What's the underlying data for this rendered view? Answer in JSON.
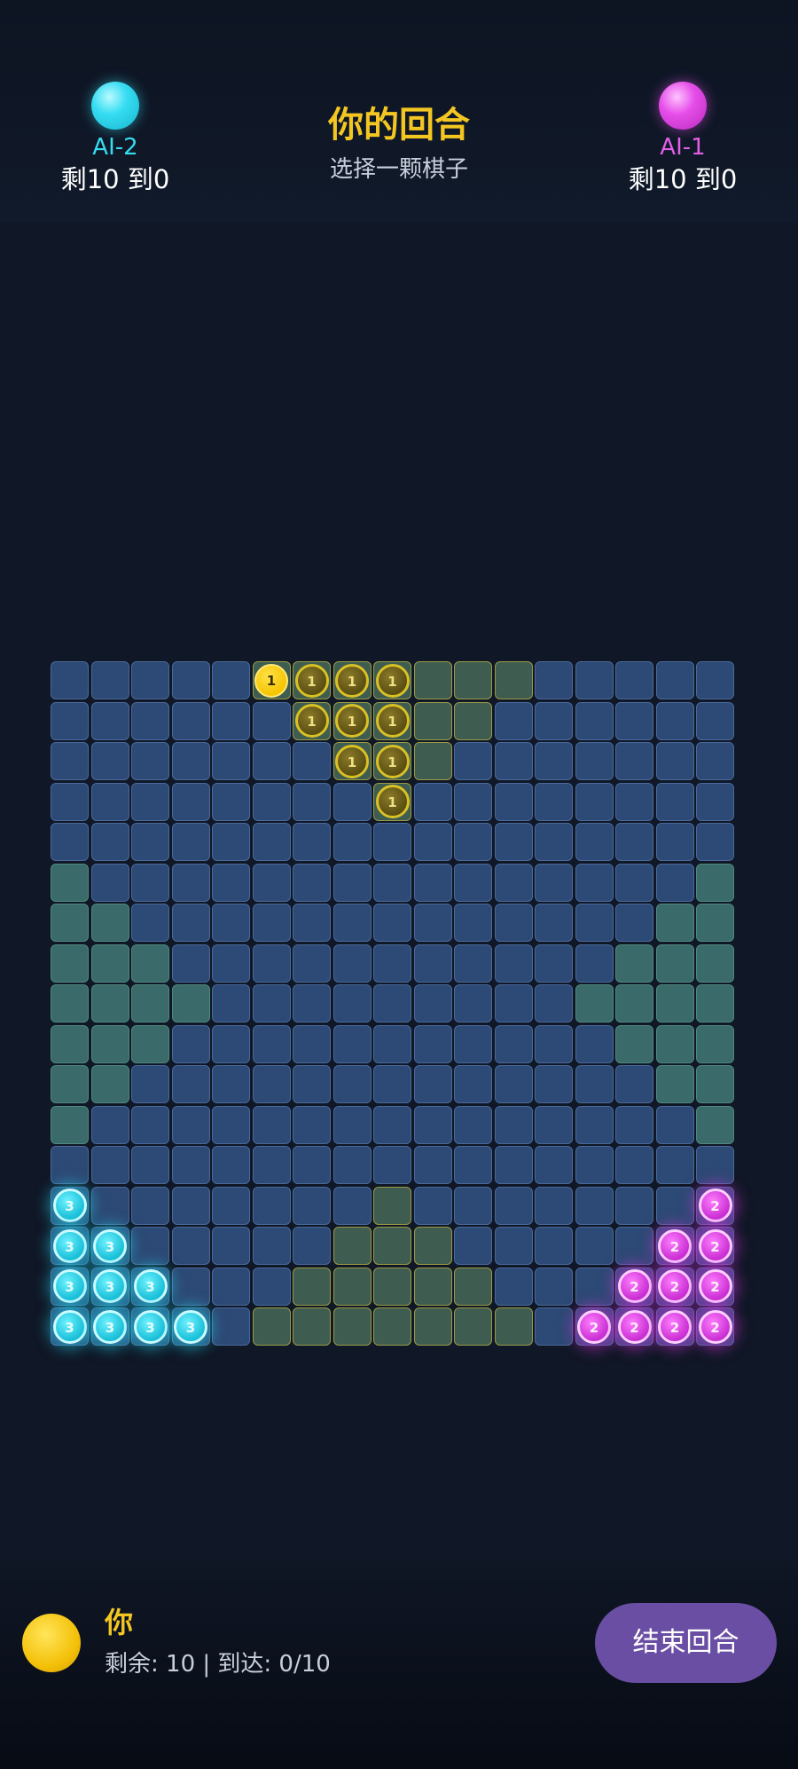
{
  "top_bar": {
    "left_player": {
      "name": "AI-2",
      "stats": "剩10 到0",
      "color": "#35dcf2"
    },
    "right_player": {
      "name": "AI-1",
      "stats": "剩10 到0",
      "color": "#e35ee6"
    },
    "turn_title": "你的回合",
    "turn_subtitle": "选择一颗棋子"
  },
  "board": {
    "size": 17,
    "colors": {
      "cell": "#2d4975",
      "home_green": "#3a6a6a",
      "home_yellow": "#3e5c50",
      "yellow": "#f3c622",
      "cyan": "#35dcf2",
      "magenta": "#e35ee6"
    },
    "home_zones": {
      "top": [
        [
          0,
          5
        ],
        [
          0,
          6
        ],
        [
          0,
          7
        ],
        [
          0,
          8
        ],
        [
          0,
          9
        ],
        [
          0,
          10
        ],
        [
          0,
          11
        ],
        [
          1,
          6
        ],
        [
          1,
          7
        ],
        [
          1,
          8
        ],
        [
          1,
          9
        ],
        [
          1,
          10
        ],
        [
          2,
          7
        ],
        [
          2,
          8
        ],
        [
          2,
          9
        ],
        [
          3,
          8
        ]
      ],
      "bottom": [
        [
          13,
          8
        ],
        [
          14,
          7
        ],
        [
          14,
          8
        ],
        [
          14,
          9
        ],
        [
          15,
          6
        ],
        [
          15,
          7
        ],
        [
          15,
          8
        ],
        [
          15,
          9
        ],
        [
          15,
          10
        ],
        [
          16,
          5
        ],
        [
          16,
          6
        ],
        [
          16,
          7
        ],
        [
          16,
          8
        ],
        [
          16,
          9
        ],
        [
          16,
          10
        ],
        [
          16,
          11
        ]
      ],
      "left": [
        [
          5,
          0
        ],
        [
          6,
          0
        ],
        [
          6,
          1
        ],
        [
          7,
          0
        ],
        [
          7,
          1
        ],
        [
          7,
          2
        ],
        [
          8,
          0
        ],
        [
          8,
          1
        ],
        [
          8,
          2
        ],
        [
          8,
          3
        ],
        [
          9,
          0
        ],
        [
          9,
          1
        ],
        [
          9,
          2
        ],
        [
          10,
          0
        ],
        [
          10,
          1
        ],
        [
          11,
          0
        ]
      ],
      "right": [
        [
          5,
          16
        ],
        [
          6,
          15
        ],
        [
          6,
          16
        ],
        [
          7,
          14
        ],
        [
          7,
          15
        ],
        [
          7,
          16
        ],
        [
          8,
          13
        ],
        [
          8,
          14
        ],
        [
          8,
          15
        ],
        [
          8,
          16
        ],
        [
          9,
          14
        ],
        [
          9,
          15
        ],
        [
          9,
          16
        ],
        [
          10,
          15
        ],
        [
          10,
          16
        ],
        [
          11,
          16
        ]
      ]
    },
    "pieces": [
      {
        "row": 0,
        "col": 5,
        "color": "yellow",
        "label": "1",
        "selected": true
      },
      {
        "row": 0,
        "col": 6,
        "color": "yellow",
        "label": "1"
      },
      {
        "row": 0,
        "col": 7,
        "color": "yellow",
        "label": "1"
      },
      {
        "row": 0,
        "col": 8,
        "color": "yellow",
        "label": "1"
      },
      {
        "row": 1,
        "col": 6,
        "color": "yellow",
        "label": "1"
      },
      {
        "row": 1,
        "col": 7,
        "color": "yellow",
        "label": "1"
      },
      {
        "row": 1,
        "col": 8,
        "color": "yellow",
        "label": "1"
      },
      {
        "row": 2,
        "col": 7,
        "color": "yellow",
        "label": "1"
      },
      {
        "row": 2,
        "col": 8,
        "color": "yellow",
        "label": "1"
      },
      {
        "row": 3,
        "col": 8,
        "color": "yellow",
        "label": "1"
      },
      {
        "row": 13,
        "col": 0,
        "color": "cyan",
        "label": "3"
      },
      {
        "row": 14,
        "col": 0,
        "color": "cyan",
        "label": "3"
      },
      {
        "row": 14,
        "col": 1,
        "color": "cyan",
        "label": "3"
      },
      {
        "row": 15,
        "col": 0,
        "color": "cyan",
        "label": "3"
      },
      {
        "row": 15,
        "col": 1,
        "color": "cyan",
        "label": "3"
      },
      {
        "row": 15,
        "col": 2,
        "color": "cyan",
        "label": "3"
      },
      {
        "row": 16,
        "col": 0,
        "color": "cyan",
        "label": "3"
      },
      {
        "row": 16,
        "col": 1,
        "color": "cyan",
        "label": "3"
      },
      {
        "row": 16,
        "col": 2,
        "color": "cyan",
        "label": "3"
      },
      {
        "row": 16,
        "col": 3,
        "color": "cyan",
        "label": "3"
      },
      {
        "row": 13,
        "col": 16,
        "color": "magenta",
        "label": "2"
      },
      {
        "row": 14,
        "col": 15,
        "color": "magenta",
        "label": "2"
      },
      {
        "row": 14,
        "col": 16,
        "color": "magenta",
        "label": "2"
      },
      {
        "row": 15,
        "col": 14,
        "color": "magenta",
        "label": "2"
      },
      {
        "row": 15,
        "col": 15,
        "color": "magenta",
        "label": "2"
      },
      {
        "row": 15,
        "col": 16,
        "color": "magenta",
        "label": "2"
      },
      {
        "row": 16,
        "col": 13,
        "color": "magenta",
        "label": "2"
      },
      {
        "row": 16,
        "col": 14,
        "color": "magenta",
        "label": "2"
      },
      {
        "row": 16,
        "col": 15,
        "color": "magenta",
        "label": "2"
      },
      {
        "row": 16,
        "col": 16,
        "color": "magenta",
        "label": "2"
      }
    ]
  },
  "bottom_bar": {
    "player_name": "你",
    "player_stats": "剩余: 10 | 到达: 0/10",
    "end_turn_label": "结束回合",
    "player_color": "#f3c622",
    "button_color": "#6a4ea3"
  }
}
